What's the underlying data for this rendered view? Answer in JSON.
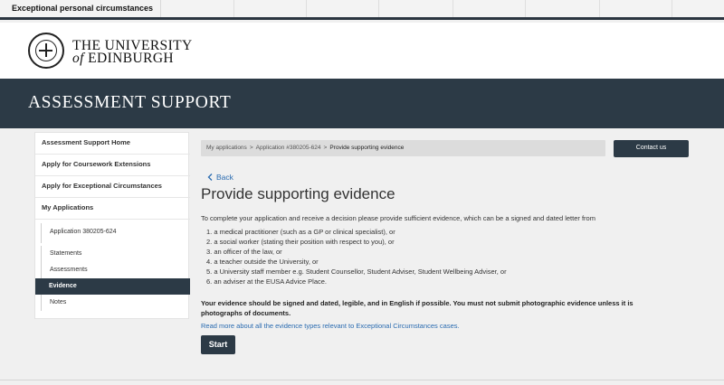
{
  "tab": {
    "title": "Exceptional personal circumstances"
  },
  "brand": {
    "line1": "THE UNIVERSITY",
    "line2_of": "of",
    "line2_rest": "EDINBURGH"
  },
  "banner": {
    "title": "ASSESSMENT SUPPORT"
  },
  "sidebar": {
    "items": [
      {
        "label": "Assessment Support Home"
      },
      {
        "label": "Apply for Coursework Extensions"
      },
      {
        "label": "Apply for Exceptional Circumstances"
      },
      {
        "label": "My Applications"
      }
    ],
    "application": "Application 380205-624",
    "subitems": [
      {
        "label": "Statements"
      },
      {
        "label": "Assessments"
      },
      {
        "label": "Evidence"
      },
      {
        "label": "Notes"
      }
    ]
  },
  "breadcrumb": {
    "items": [
      "My applications",
      "Application #380205-624",
      "Provide supporting evidence"
    ],
    "separator": ">"
  },
  "contact_label": "Contact us",
  "back_label": "Back",
  "page_title": "Provide supporting evidence",
  "intro": "To complete your application and receive a decision please provide sufficient evidence, which can be a signed and dated letter from",
  "evidence_list": [
    "1. a medical practitioner (such as a GP or clinical specialist), or",
    "2. a social worker (stating their position with respect to you), or",
    "3. an officer of the law, or",
    "4. a teacher outside the University, or",
    "5. a University staff member e.g. Student Counsellor, Student Adviser, Student Wellbeing Adviser, or",
    "6. an adviser at the EUSA Advice Place."
  ],
  "note": "Your evidence should be signed and dated, legible, and in English if possible. You must not submit photographic evidence unless it is photographs of documents.",
  "read_more": "Read more about all the evidence types relevant to Exceptional Circumstances cases.",
  "start_label": "Start",
  "colors": {
    "dark": "#2c3a46",
    "link": "#2a6bb0",
    "background": "#f0f0f0"
  },
  "icons": {
    "back": "chevron-left-icon",
    "crest": "university-crest-icon"
  }
}
